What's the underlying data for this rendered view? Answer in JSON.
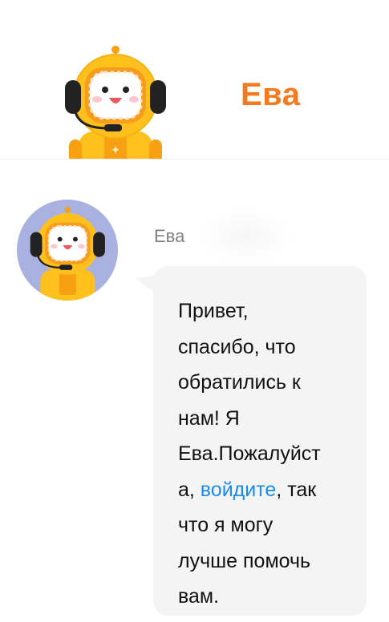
{
  "header": {
    "title": "Ева",
    "avatar_icon": "astronaut-robot-icon"
  },
  "message": {
    "sender": "Ева",
    "avatar_icon": "astronaut-robot-icon",
    "line1": "Привет,\nспасибо, что\nобратились к\nнам! Я\nЕва.Пожалуйст\nа, ",
    "link": "войдите",
    "line2": ", так\nчто я могу\nлучше помочь\nвам."
  },
  "colors": {
    "accent": "#f47a20",
    "link": "#1a8bea",
    "bubble": "#f4f4f4",
    "avatar_bg": "#a9b1e0",
    "robot_yellow": "#fdc01c"
  }
}
